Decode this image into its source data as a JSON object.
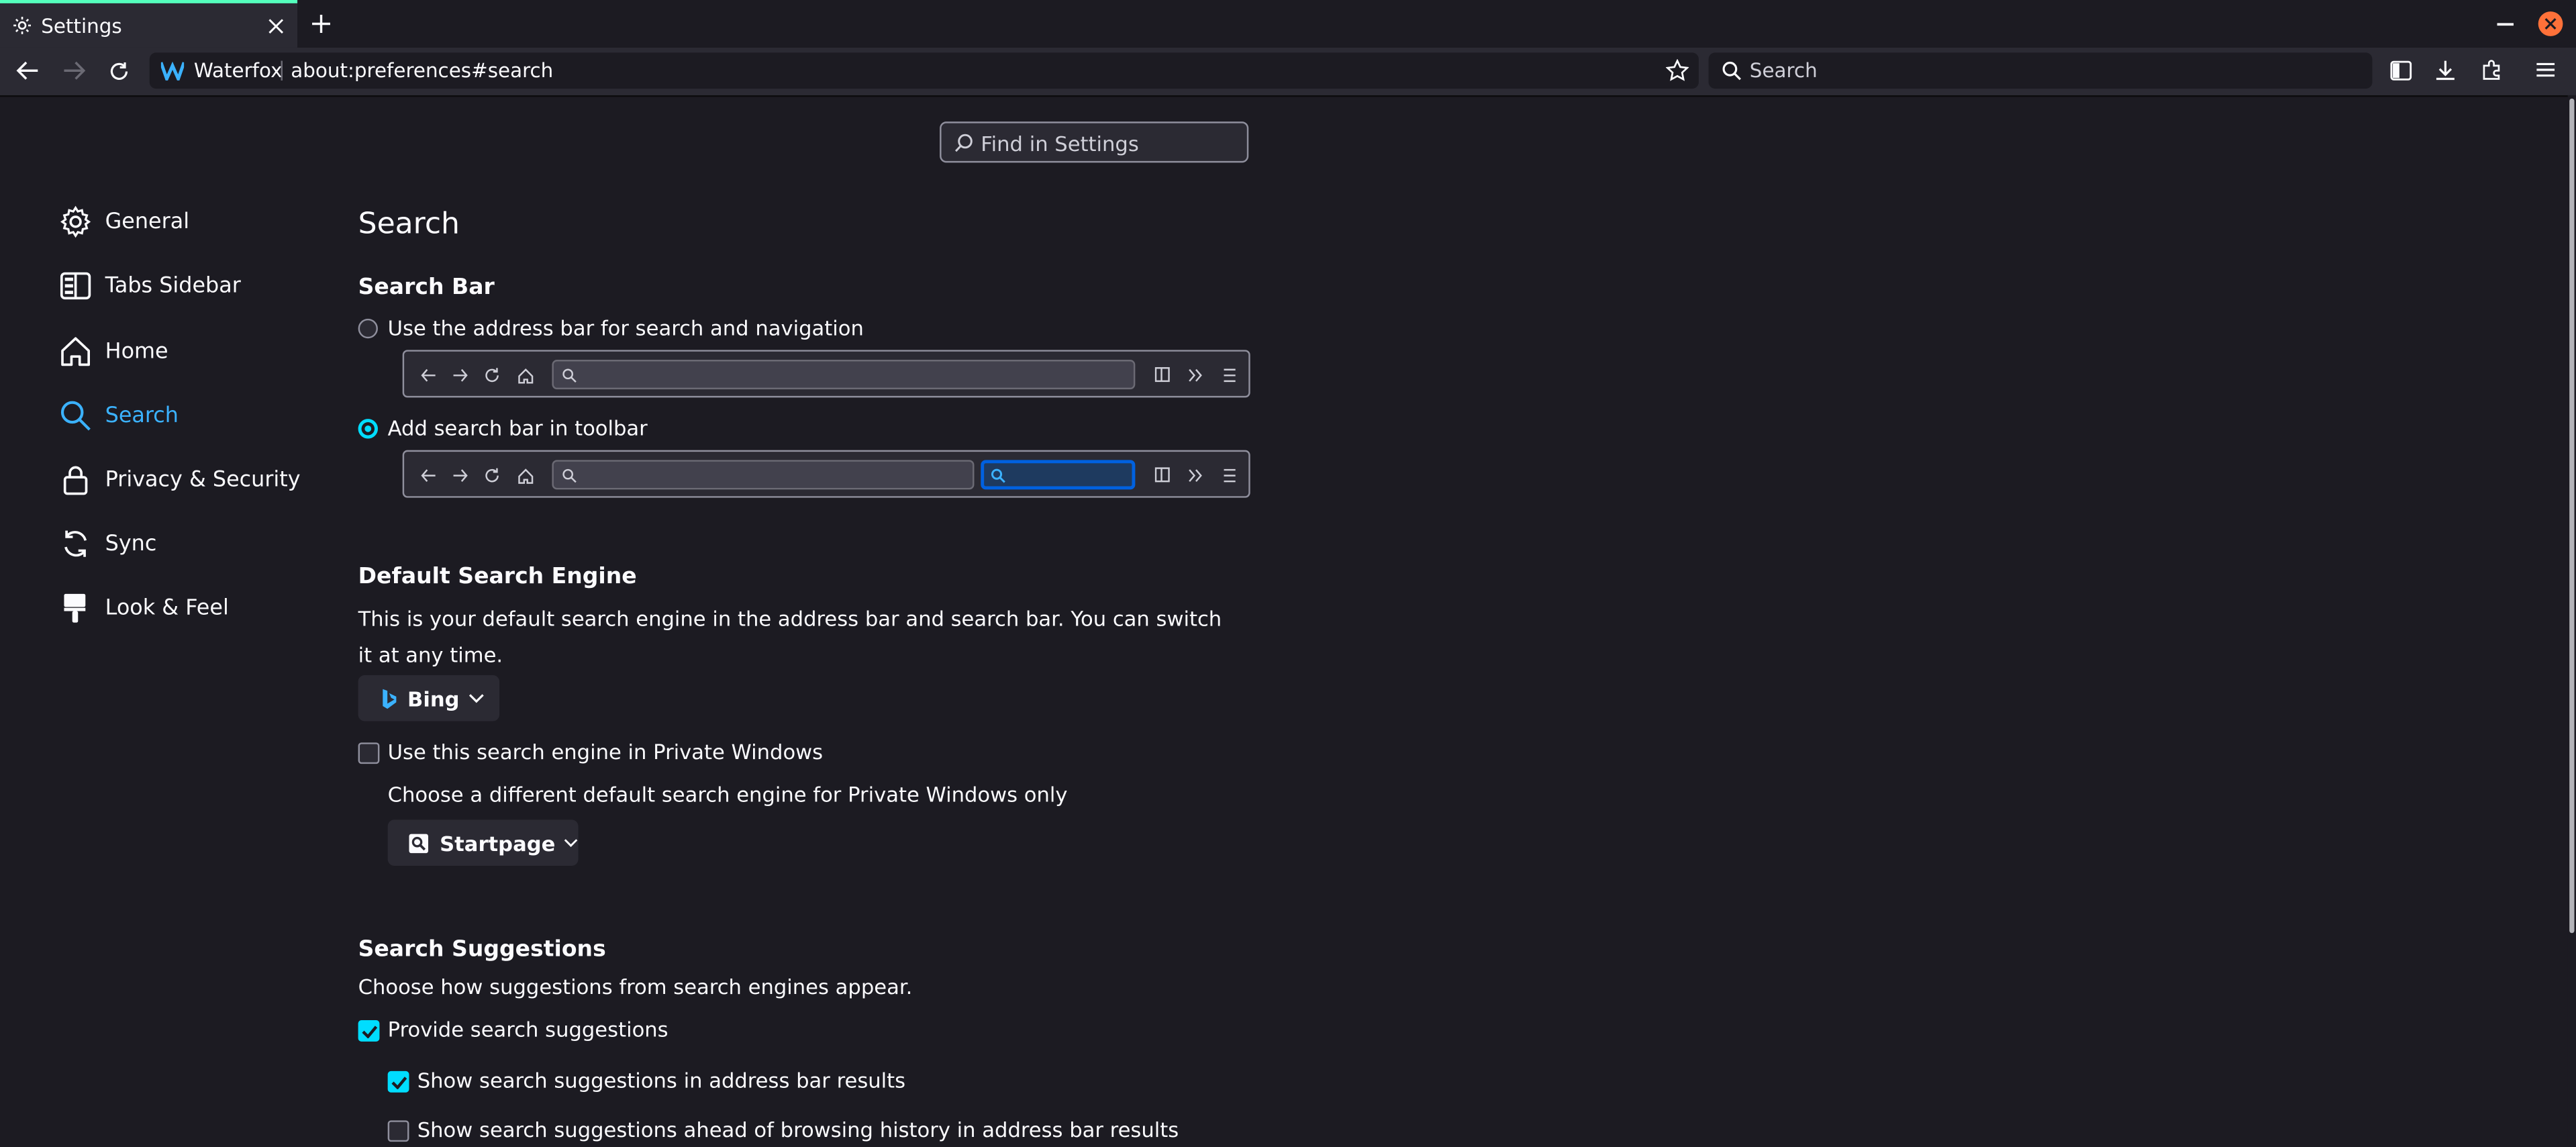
{
  "browser": {
    "tab_title": "Settings",
    "url_site": "Waterfox",
    "url_path": "about:preferences#search",
    "search_placeholder": "Search"
  },
  "settings": {
    "find_placeholder": "Find in Settings",
    "nav": [
      {
        "label": "General",
        "icon": "gear-icon"
      },
      {
        "label": "Tabs Sidebar",
        "icon": "tabs-sidebar-icon"
      },
      {
        "label": "Home",
        "icon": "home-icon"
      },
      {
        "label": "Search",
        "icon": "search-icon",
        "selected": true
      },
      {
        "label": "Privacy & Security",
        "icon": "lock-icon"
      },
      {
        "label": "Sync",
        "icon": "sync-icon"
      },
      {
        "label": "Look & Feel",
        "icon": "paintbrush-icon"
      }
    ],
    "page_title": "Search",
    "search_bar": {
      "heading": "Search Bar",
      "option_address": "Use the address bar for search and navigation",
      "option_toolbar": "Add search bar in toolbar",
      "selected": "toolbar"
    },
    "default_engine": {
      "heading": "Default Search Engine",
      "description": "This is your default search engine in the address bar and search bar. You can switch it at any time.",
      "engine": "Bing",
      "private_checkbox": "Use this search engine in Private Windows",
      "private_checked": false,
      "private_description": "Choose a different default search engine for Private Windows only",
      "private_engine": "Startpage"
    },
    "suggestions": {
      "heading": "Search Suggestions",
      "description": "Choose how suggestions from search engines appear.",
      "provide": "Provide search suggestions",
      "provide_checked": true,
      "show_in_address": "Show search suggestions in address bar results",
      "show_in_address_checked": true,
      "ahead_of_history": "Show search suggestions ahead of browsing history in address bar results",
      "ahead_of_history_checked": false
    }
  },
  "colors": {
    "accent": "#00ddff",
    "selected_nav": "#3bb2ff",
    "window_close": "#ff7139"
  }
}
